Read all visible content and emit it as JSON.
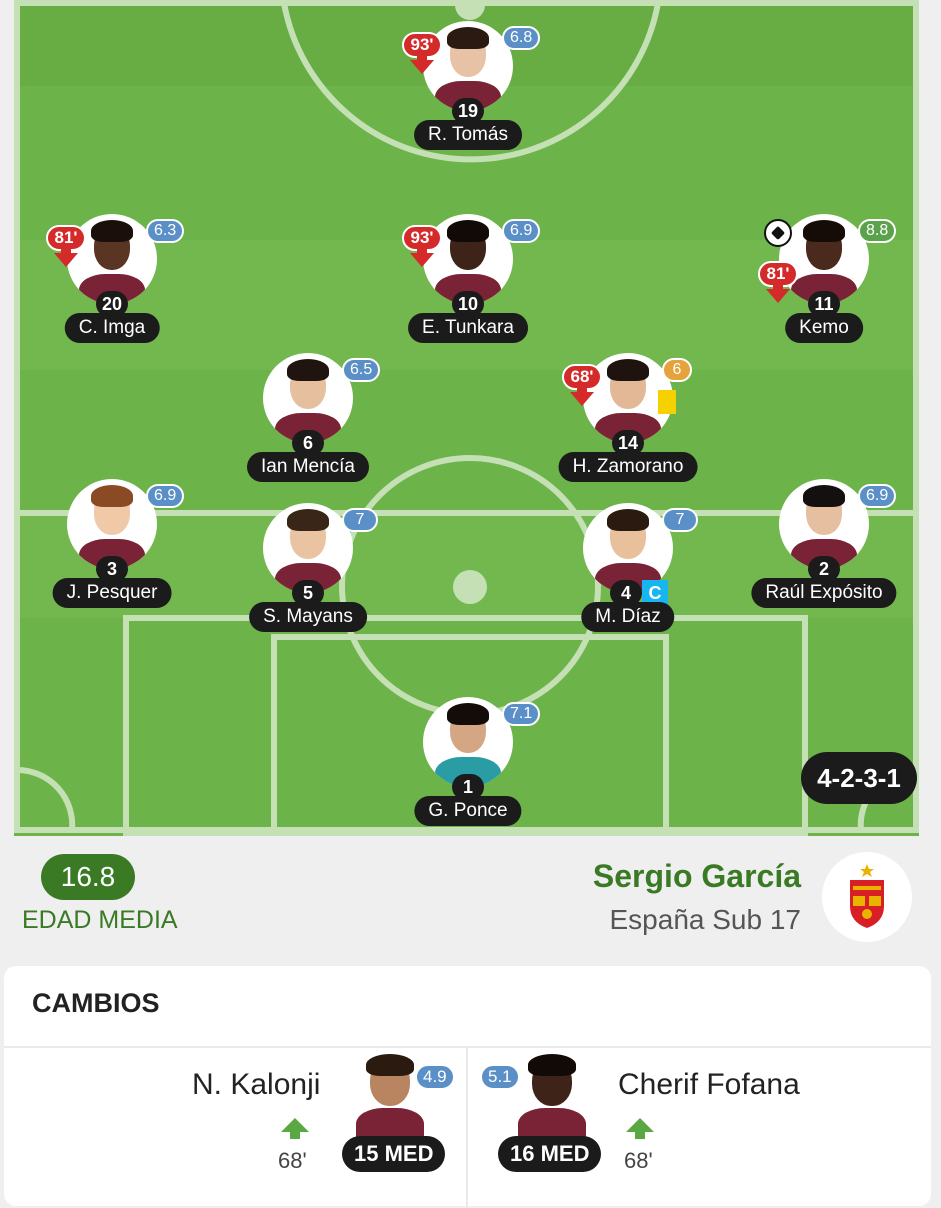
{
  "team": {
    "formation": "4-2-3-1",
    "average_age": "16.8",
    "average_age_label": "EDAD MEDIA",
    "coach": "Sergio García",
    "name": "España Sub 17"
  },
  "colors": {
    "pitch": "#6cb349",
    "rating_blue": "#5b8fc7",
    "rating_green": "#5ba24c",
    "rating_orange": "#e6a23c",
    "sub_red": "#d42a2a",
    "accent_green": "#3a7a25"
  },
  "players": [
    {
      "id": "tomas",
      "name": "R. Tomás",
      "number": "19",
      "rating": "6.8",
      "rating_color": "blue",
      "sub_off": "93'"
    },
    {
      "id": "imga",
      "name": "C. Imga",
      "number": "20",
      "rating": "6.3",
      "rating_color": "blue",
      "sub_off": "81'"
    },
    {
      "id": "tunkara",
      "name": "E. Tunkara",
      "number": "10",
      "rating": "6.9",
      "rating_color": "blue",
      "sub_off": "93'"
    },
    {
      "id": "kemo",
      "name": "Kemo",
      "number": "11",
      "rating": "8.8",
      "rating_color": "green",
      "sub_off": "81'",
      "goal": true
    },
    {
      "id": "mencia",
      "name": "Ian Mencía",
      "number": "6",
      "rating": "6.5",
      "rating_color": "blue"
    },
    {
      "id": "zamorano",
      "name": "H. Zamorano",
      "number": "14",
      "rating": "6",
      "rating_color": "orange",
      "sub_off": "68'",
      "yellow_card": true
    },
    {
      "id": "pesquer",
      "name": "J. Pesquer",
      "number": "3",
      "rating": "6.9",
      "rating_color": "blue"
    },
    {
      "id": "mayans",
      "name": "S. Mayans",
      "number": "5",
      "rating": "7",
      "rating_color": "blue"
    },
    {
      "id": "diaz",
      "name": "M. Díaz",
      "number": "4",
      "rating": "7",
      "rating_color": "blue",
      "captain": "C"
    },
    {
      "id": "exposito",
      "name": "Raúl Expósito",
      "number": "2",
      "rating": "6.9",
      "rating_color": "blue"
    },
    {
      "id": "ponce",
      "name": "G. Ponce",
      "number": "1",
      "rating": "7.1",
      "rating_color": "blue"
    }
  ],
  "changes": {
    "title": "CAMBIOS",
    "items": [
      {
        "name": "N. Kalonji",
        "minute": "68'",
        "position": "15 MED",
        "rating": "4.9"
      },
      {
        "name": "Cherif Fofana",
        "minute": "68'",
        "position": "16 MED",
        "rating": "5.1"
      }
    ]
  }
}
